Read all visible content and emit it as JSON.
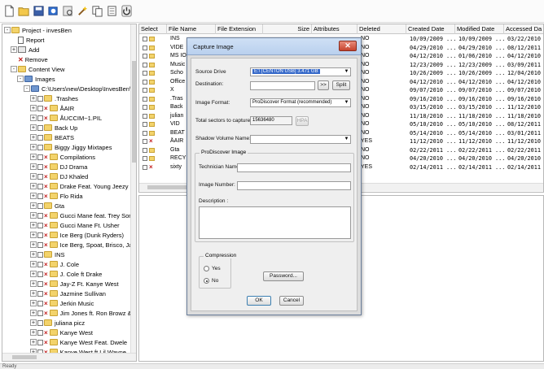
{
  "toolbar": {
    "icons": [
      "new-icon",
      "open-icon",
      "save-icon",
      "capture-icon",
      "browse-icon",
      "wand-icon",
      "copy-icon",
      "copy2-icon",
      "power-icon"
    ]
  },
  "tree": {
    "items": [
      {
        "label": "Project - invesBen",
        "indent": 0,
        "exp": "-",
        "kind": "folder"
      },
      {
        "label": "Report",
        "indent": 1,
        "exp": "",
        "kind": "doc"
      },
      {
        "label": "Add",
        "indent": 1,
        "exp": "+",
        "kind": "add"
      },
      {
        "label": "Remove",
        "indent": 1,
        "exp": "",
        "kind": "remove"
      },
      {
        "label": "Content View",
        "indent": 1,
        "exp": "-",
        "kind": "folder"
      },
      {
        "label": "Images",
        "indent": 2,
        "exp": "-",
        "kind": "blue"
      },
      {
        "label": "C:\\Users\\new\\Desktop\\InvesBen\\",
        "indent": 3,
        "exp": "-",
        "kind": "blue"
      },
      {
        "label": ".Trashes",
        "indent": 4,
        "exp": "+",
        "kind": "folder"
      },
      {
        "label": "ÅAIR",
        "indent": 4,
        "exp": "+",
        "kind": "bad"
      },
      {
        "label": "ÅUCCIM~1.PIL",
        "indent": 4,
        "exp": "+",
        "kind": "bad"
      },
      {
        "label": "Back Up",
        "indent": 4,
        "exp": "+",
        "kind": "folder"
      },
      {
        "label": "BEATS",
        "indent": 4,
        "exp": "+",
        "kind": "folder"
      },
      {
        "label": "Biggy Jiggy Mixtapes",
        "indent": 4,
        "exp": "+",
        "kind": "folder"
      },
      {
        "label": "Compilations",
        "indent": 4,
        "exp": "+",
        "kind": "bad"
      },
      {
        "label": "DJ Drama",
        "indent": 4,
        "exp": "+",
        "kind": "bad"
      },
      {
        "label": "DJ Khaled",
        "indent": 4,
        "exp": "+",
        "kind": "bad"
      },
      {
        "label": "Drake Feat. Young Jeezy",
        "indent": 4,
        "exp": "+",
        "kind": "bad"
      },
      {
        "label": "Flo Rida",
        "indent": 4,
        "exp": "+",
        "kind": "bad"
      },
      {
        "label": "Gta",
        "indent": 4,
        "exp": "+",
        "kind": "folder"
      },
      {
        "label": "Gucci Mane feat. Trey Songz",
        "indent": 4,
        "exp": "+",
        "kind": "bad"
      },
      {
        "label": "Gucci Mane Ft. Usher",
        "indent": 4,
        "exp": "+",
        "kind": "bad"
      },
      {
        "label": "Ice Berg (Dunk Ryders)",
        "indent": 4,
        "exp": "+",
        "kind": "bad"
      },
      {
        "label": "Ice Berg, Spoat, Brisco, Jay",
        "indent": 4,
        "exp": "+",
        "kind": "bad"
      },
      {
        "label": "INS",
        "indent": 4,
        "exp": "+",
        "kind": "folder"
      },
      {
        "label": "J. Cole",
        "indent": 4,
        "exp": "+",
        "kind": "bad"
      },
      {
        "label": "J. Cole ft Drake",
        "indent": 4,
        "exp": "+",
        "kind": "bad"
      },
      {
        "label": "Jay-Z Ft. Kanye West",
        "indent": 4,
        "exp": "+",
        "kind": "bad"
      },
      {
        "label": "Jazmine Sullivan",
        "indent": 4,
        "exp": "+",
        "kind": "bad"
      },
      {
        "label": "Jerkin Music",
        "indent": 4,
        "exp": "+",
        "kind": "bad"
      },
      {
        "label": "Jim Jones ft. Ron Browz & Juel",
        "indent": 4,
        "exp": "+",
        "kind": "bad"
      },
      {
        "label": "juliana picz",
        "indent": 4,
        "exp": "+",
        "kind": "folder"
      },
      {
        "label": "Kanye West",
        "indent": 4,
        "exp": "+",
        "kind": "bad"
      },
      {
        "label": "Kanye West Feat. Dwele",
        "indent": 4,
        "exp": "+",
        "kind": "bad"
      },
      {
        "label": "Kanye West ft Lil Wayne",
        "indent": 4,
        "exp": "+",
        "kind": "bad"
      }
    ]
  },
  "list": {
    "headers": [
      "Select",
      "File Name",
      "File Extension",
      "Size",
      "Attributes",
      "Deleted",
      "Created Date",
      "Modified Date",
      "Accessed Da"
    ],
    "rows": [
      {
        "name": "INS",
        "deleted": "NO",
        "created": "10/09/2009 ...",
        "modified": "10/09/2009 ...",
        "accessed": "03/22/2010",
        "bad": false
      },
      {
        "name": "VIDE",
        "deleted": "NO",
        "created": "04/29/2010 ...",
        "modified": "04/29/2010 ...",
        "accessed": "08/12/2011",
        "bad": false
      },
      {
        "name": "MS IO",
        "deleted": "NO",
        "created": "04/12/2010 ...",
        "modified": "01/06/2010 ...",
        "accessed": "04/12/2010",
        "bad": false
      },
      {
        "name": "Music",
        "deleted": "NO",
        "created": "12/23/2009 ...",
        "modified": "12/23/2009 ...",
        "accessed": "03/09/2011",
        "bad": false
      },
      {
        "name": "Scho",
        "deleted": "NO",
        "created": "10/26/2009 ...",
        "modified": "10/26/2009 ...",
        "accessed": "12/04/2010",
        "bad": false
      },
      {
        "name": "Office",
        "deleted": "NO",
        "created": "04/12/2010 ...",
        "modified": "04/12/2010 ...",
        "accessed": "04/12/2010",
        "bad": false
      },
      {
        "name": "X",
        "deleted": "NO",
        "created": "09/07/2010 ...",
        "modified": "09/07/2010 ...",
        "accessed": "09/07/2010",
        "bad": false
      },
      {
        "name": ".Tras",
        "deleted": "NO",
        "created": "09/16/2010 ...",
        "modified": "09/16/2010 ...",
        "accessed": "09/16/2010",
        "bad": false
      },
      {
        "name": "Back",
        "deleted": "NO",
        "created": "03/15/2010 ...",
        "modified": "03/15/2010 ...",
        "accessed": "11/12/2010",
        "bad": false
      },
      {
        "name": "julian",
        "deleted": "NO",
        "created": "11/18/2010 ...",
        "modified": "11/18/2010 ...",
        "accessed": "11/18/2010",
        "bad": false
      },
      {
        "name": "VID",
        "deleted": "NO",
        "created": "05/10/2010 ...",
        "modified": "05/10/2010 ...",
        "accessed": "08/12/2011",
        "bad": false
      },
      {
        "name": "BEAT",
        "deleted": "NO",
        "created": "05/14/2010 ...",
        "modified": "05/14/2010 ...",
        "accessed": "03/01/2011",
        "bad": false
      },
      {
        "name": "ÅAIR",
        "deleted": "YES",
        "created": "11/12/2010 ...",
        "modified": "11/12/2010 ...",
        "accessed": "11/12/2010",
        "bad": true
      },
      {
        "name": "Gta",
        "deleted": "NO",
        "created": "02/22/2011 ...",
        "modified": "02/22/2011 ...",
        "accessed": "02/22/2011",
        "bad": false
      },
      {
        "name": "RECY",
        "deleted": "NO",
        "created": "04/20/2010 ...",
        "modified": "04/20/2010 ...",
        "accessed": "04/20/2010",
        "bad": false
      },
      {
        "name": "sixty",
        "deleted": "YES",
        "created": "02/14/2011 ...",
        "modified": "02/14/2011 ...",
        "accessed": "02/14/2011",
        "bad": true
      }
    ]
  },
  "dialog": {
    "title": "Capture Image",
    "close_label": "✕",
    "source_drive_label": "Source Drive",
    "source_drive_value": "E:\\ [CENTON USB] 3.471 GB",
    "destination_label": "Destination:",
    "browse_label": ">>",
    "split_label": "Split",
    "image_format_label": "Image Format:",
    "image_format_value": "ProDiscover Format (recommended)",
    "total_sectors_label": "Total sectors to capture:",
    "total_sectors_value": "15636480",
    "hpa_label": "HPA",
    "shadow_volume_label": "Shadow Volume Name:",
    "group_title": "ProDiscover Image",
    "technician_label": "Technician Name:",
    "image_number_label": "Image Number:",
    "description_label": "Description :",
    "compression_label": "Compression",
    "yes_label": "Yes",
    "no_label": "No",
    "password_label": "Password...",
    "ok_label": "OK",
    "cancel_label": "Cancel"
  },
  "status": {
    "text": "Ready"
  }
}
